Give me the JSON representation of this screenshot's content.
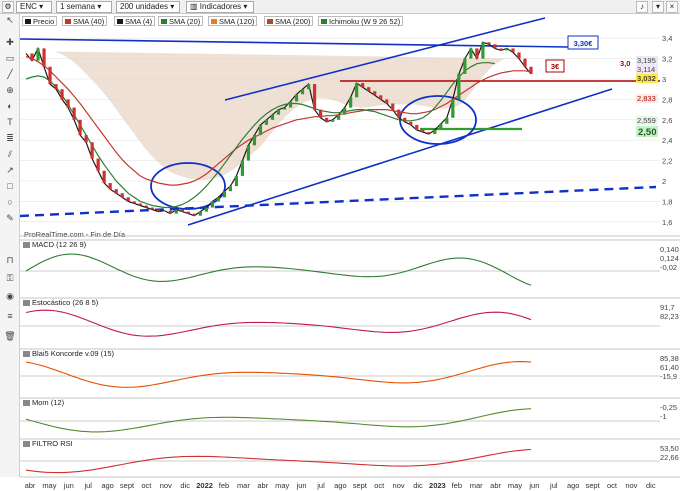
{
  "toolbar": {
    "symbol": "ENC",
    "interval": "1 semana",
    "units": "200 unidades",
    "indicators_label": "Indicadores"
  },
  "legend": {
    "price": "Precio",
    "sma40": "SMA (40)",
    "sma4": "SMA (4)",
    "sma20": "SMA (20)",
    "sma120": "SMA (120)",
    "sma200": "SMA (200)",
    "ichimoku": "Ichimoku (W 9 26 52)"
  },
  "colors": {
    "price": "#1a1a1a",
    "sma40": "#c0392b",
    "sma4": "#8e44ad",
    "sma20": "#2e7d32",
    "sma120": "#e67e22",
    "sma200": "#a0522d",
    "kumo_bull": "#b9e6f4",
    "kumo_bear": "#e8d6c6",
    "trendline": "#1030c8",
    "resistance": "#b00000",
    "green_band": "#3cc83c"
  },
  "source_label": "ProRealTime.com - Fin de Día",
  "annotations": {
    "resistance_label": "3,30€",
    "level_label": "3€"
  },
  "price_labels": [
    "3,195",
    "3,114",
    "3,032"
  ],
  "lower_price_labels": [
    "2,833",
    "2,559",
    "2,50"
  ],
  "side_price_label": "3,0",
  "panels": {
    "macd": {
      "title": "MACD (12 26 9)",
      "values": [
        "0,140",
        "0,124",
        "-0,02"
      ]
    },
    "stoch": {
      "title": "Estocástico (26 8 5)",
      "values": [
        "91,7",
        "82,23"
      ]
    },
    "koncorde": {
      "title": "Blai5 Koncorde v.09 (15)",
      "values": [
        "85,38",
        "61,40",
        "-15,9"
      ]
    },
    "mom": {
      "title": "Mom (12)",
      "values": [
        "-0,25",
        "-1"
      ]
    },
    "rsi": {
      "title": "FILTRO RSI",
      "values": [
        "53,50",
        "22,66"
      ]
    }
  },
  "chart_data": {
    "type": "line",
    "title": "ENC",
    "frequency": "weekly",
    "x_tick_labels": [
      "abr",
      "may",
      "jun",
      "jul",
      "ago",
      "sept",
      "oct",
      "nov",
      "dic",
      "2022",
      "feb",
      "mar",
      "abr",
      "may",
      "jun",
      "jul",
      "ago",
      "sept",
      "oct",
      "nov",
      "dic",
      "2023",
      "feb",
      "mar",
      "abr",
      "may",
      "jun",
      "jul",
      "ago",
      "sept",
      "oct",
      "nov",
      "dic"
    ],
    "y_ticks": [
      1.6,
      1.8,
      2.0,
      2.2,
      2.4,
      2.6,
      2.8,
      3.0,
      3.2,
      3.4
    ],
    "ylim": [
      1.5,
      3.5
    ],
    "series": [
      {
        "name": "Precio",
        "values": [
          3.25,
          3.18,
          3.3,
          3.12,
          2.95,
          2.9,
          2.8,
          2.72,
          2.6,
          2.45,
          2.38,
          2.22,
          2.1,
          1.98,
          1.92,
          1.88,
          1.84,
          1.8,
          1.78,
          1.76,
          1.74,
          1.72,
          1.7,
          1.71,
          1.68,
          1.72,
          1.7,
          1.68,
          1.66,
          1.7,
          1.74,
          1.8,
          1.84,
          1.9,
          1.95,
          2.05,
          2.2,
          2.35,
          2.45,
          2.55,
          2.6,
          2.65,
          2.7,
          2.72,
          2.78,
          2.85,
          2.9,
          2.95,
          2.7,
          2.62,
          2.58,
          2.6,
          2.65,
          2.72,
          2.82,
          2.96,
          2.92,
          2.88,
          2.84,
          2.8,
          2.76,
          2.7,
          2.62,
          2.58,
          2.55,
          2.5,
          2.48,
          2.46,
          2.5,
          2.56,
          2.62,
          2.8,
          3.05,
          3.2,
          3.3,
          3.2,
          3.36,
          3.34,
          3.3,
          3.28,
          3.3,
          3.26,
          3.2,
          3.12,
          3.05
        ]
      },
      {
        "name": "SMA (40)",
        "values": [
          3.22,
          3.2,
          3.17,
          3.13,
          3.08,
          3.02,
          2.96,
          2.9,
          2.83,
          2.76,
          2.68,
          2.6,
          2.52,
          2.44,
          2.36,
          2.28,
          2.21,
          2.15,
          2.1,
          2.05,
          2.02,
          2.0,
          1.98,
          1.97,
          1.96,
          1.96,
          1.97,
          1.98,
          2.0,
          2.03,
          2.07,
          2.12,
          2.17,
          2.22,
          2.27,
          2.32,
          2.36,
          2.4,
          2.43,
          2.46,
          2.49,
          2.52,
          2.54,
          2.56,
          2.58,
          2.6,
          2.61,
          2.62,
          2.63,
          2.63,
          2.64,
          2.64,
          2.65,
          2.66,
          2.67,
          2.68,
          2.69,
          2.7,
          2.7,
          2.7,
          2.7,
          2.69,
          2.68,
          2.67,
          2.66,
          2.66,
          2.67,
          2.68,
          2.7,
          2.73,
          2.76,
          2.8,
          2.84,
          2.88,
          2.92,
          2.96,
          2.99,
          3.02,
          3.04,
          3.06,
          3.07,
          3.08,
          3.08,
          3.08,
          3.07
        ]
      },
      {
        "name": "SMA (20)",
        "values": [
          3.0,
          3.02,
          3.03,
          3.02,
          2.98,
          2.92,
          2.84,
          2.75,
          2.65,
          2.55,
          2.45,
          2.35,
          2.25,
          2.16,
          2.08,
          2.0,
          1.94,
          1.88,
          1.84,
          1.8,
          1.78,
          1.76,
          1.75,
          1.74,
          1.74,
          1.75,
          1.77,
          1.8,
          1.84,
          1.89,
          1.95,
          2.02,
          2.09,
          2.17,
          2.25,
          2.33,
          2.41,
          2.48,
          2.55,
          2.61,
          2.66,
          2.7,
          2.73,
          2.75,
          2.76,
          2.76,
          2.75,
          2.73,
          2.71,
          2.69,
          2.68,
          2.67,
          2.67,
          2.68,
          2.69,
          2.7,
          2.7,
          2.69,
          2.68,
          2.66,
          2.64,
          2.62,
          2.6,
          2.59,
          2.59,
          2.6,
          2.62,
          2.66,
          2.72,
          2.79,
          2.87,
          2.95,
          3.02,
          3.08,
          3.12,
          3.15,
          3.16,
          3.16,
          3.15
        ]
      }
    ]
  }
}
